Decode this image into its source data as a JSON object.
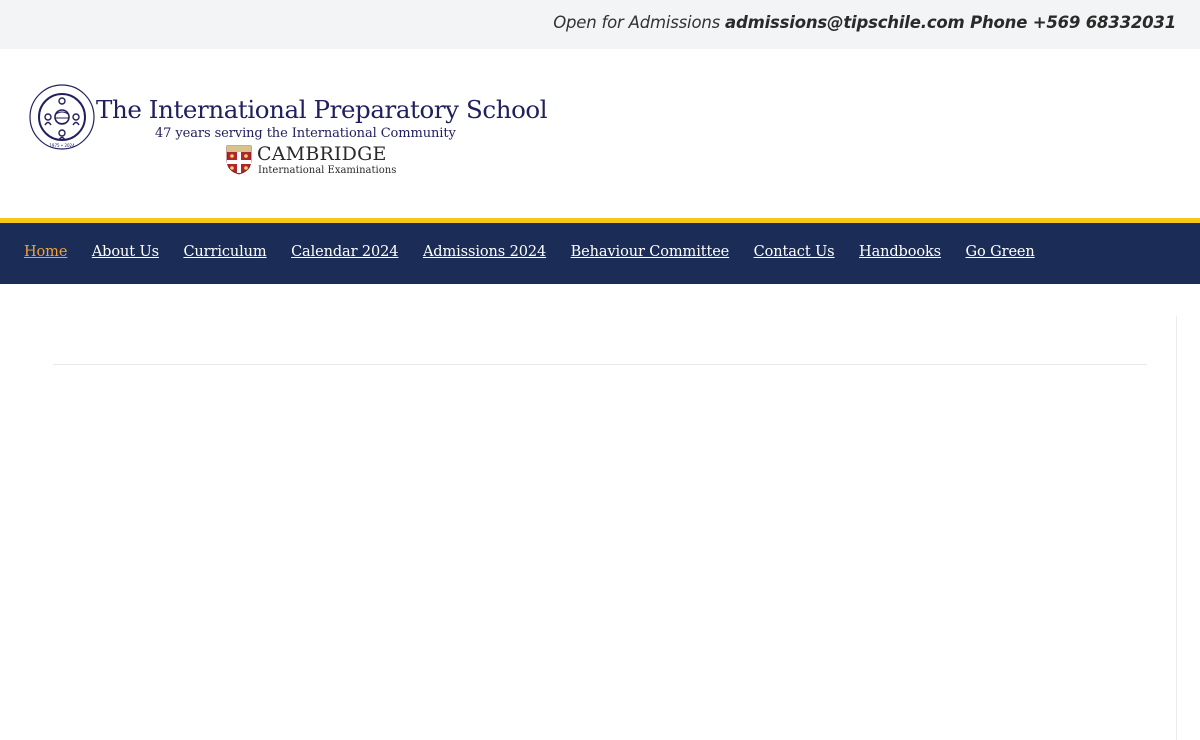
{
  "topbar": {
    "prefix": "Open for Admissions ",
    "email": "admissions@tipschile.com",
    "phone": " Phone +569 68332031"
  },
  "logo": {
    "school_name": "The International Preparatory School",
    "tagline": "47 years serving the International Community",
    "cambridge": "CAMBRIDGE",
    "cambridge_sub": "International Examinations",
    "seal_text": "THE INTERNATIONAL PREPARATORY SCHOOL"
  },
  "nav": {
    "items": [
      {
        "label": "Home",
        "active": true
      },
      {
        "label": "About Us"
      },
      {
        "label": "Curriculum"
      },
      {
        "label": "Calendar 2024"
      },
      {
        "label": "Admissions 2024"
      },
      {
        "label": "Behaviour Committee"
      },
      {
        "label": "Contact Us"
      },
      {
        "label": "Handbooks"
      },
      {
        "label": "Go Green"
      }
    ]
  },
  "colors": {
    "nav_bg": "#1b2d56",
    "nav_accent": "#f6c619",
    "active_link": "#f0a23a",
    "brand_navy": "#21205e"
  }
}
